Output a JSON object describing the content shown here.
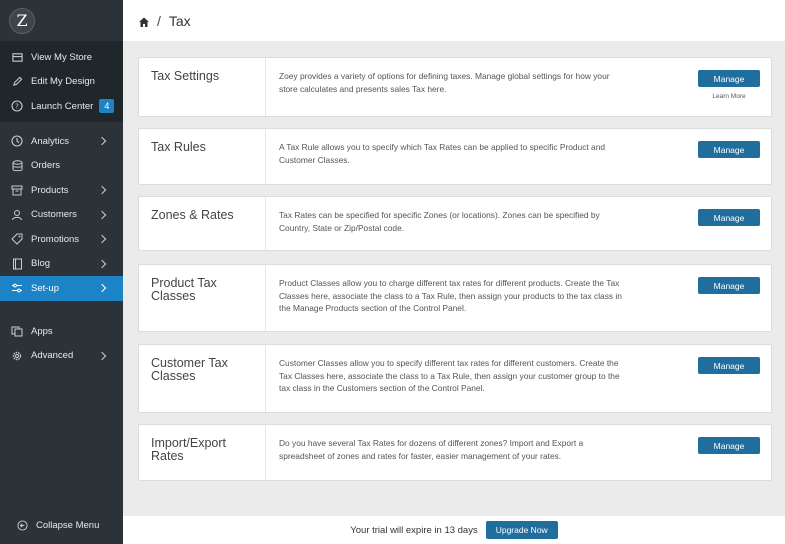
{
  "logo": {
    "letter": "Z"
  },
  "sidebar": {
    "top": [
      {
        "label": "View My Store",
        "icon": "store-icon"
      },
      {
        "label": "Edit My Design",
        "icon": "pencil-icon"
      },
      {
        "label": "Launch Center",
        "icon": "question-circle-icon",
        "badge": "4"
      }
    ],
    "mid": [
      {
        "label": "Analytics",
        "icon": "clock-icon",
        "chevron": true
      },
      {
        "label": "Orders",
        "icon": "database-icon",
        "chevron": false
      },
      {
        "label": "Products",
        "icon": "box-icon",
        "chevron": true
      },
      {
        "label": "Customers",
        "icon": "user-icon",
        "chevron": true
      },
      {
        "label": "Promotions",
        "icon": "tag-icon",
        "chevron": true
      },
      {
        "label": "Blog",
        "icon": "book-icon",
        "chevron": true
      },
      {
        "label": "Set-up",
        "icon": "sliders-icon",
        "chevron": true,
        "active": true
      }
    ],
    "low": [
      {
        "label": "Apps",
        "icon": "apps-icon",
        "chevron": false
      },
      {
        "label": "Advanced",
        "icon": "gear-icon",
        "chevron": true
      }
    ],
    "collapse_label": "Collapse Menu"
  },
  "header": {
    "separator": "/",
    "title": "Tax"
  },
  "cards": [
    {
      "name": "Tax Settings",
      "desc": "Zoey provides a variety of options for defining taxes. Manage global settings for how your store calculates and presents sales Tax here.",
      "button": "Manage",
      "extra": "Learn More"
    },
    {
      "name": "Tax Rules",
      "desc": "A Tax Rule allows you to specify which Tax Rates can be applied to specific Product and Customer Classes.",
      "button": "Manage"
    },
    {
      "name": "Zones & Rates",
      "desc": "Tax Rates can be specified for specific Zones (or locations). Zones can be specified by Country, State or Zip/Postal code.",
      "button": "Manage"
    },
    {
      "name": "Product Tax Classes",
      "desc": "Product Classes allow you to charge different tax rates for different products. Create the Tax Classes here, associate the class to a Tax Rule, then assign your products to the tax class in the Manage Products section of the Control Panel.",
      "button": "Manage"
    },
    {
      "name": "Customer Tax Classes",
      "desc": "Customer Classes allow you to specify different tax rates for different customers. Create the Tax Classes here, associate the class to a Tax Rule, then assign your customer group to the tax class in the Customers section of the Control Panel.",
      "button": "Manage"
    },
    {
      "name": "Import/Export Rates",
      "desc": "Do you have several Tax Rates for dozens of different zones? Import and Export a spreadsheet of zones and rates for faster, easier management of your rates.",
      "button": "Manage"
    }
  ],
  "footer": {
    "message": "Your trial will expire in 13 days",
    "button": "Upgrade Now"
  },
  "colors": {
    "sidebar": "#2b3338",
    "sidebar_dark": "#20272b",
    "accent": "#1c84c6",
    "button": "#1f6e9e"
  }
}
